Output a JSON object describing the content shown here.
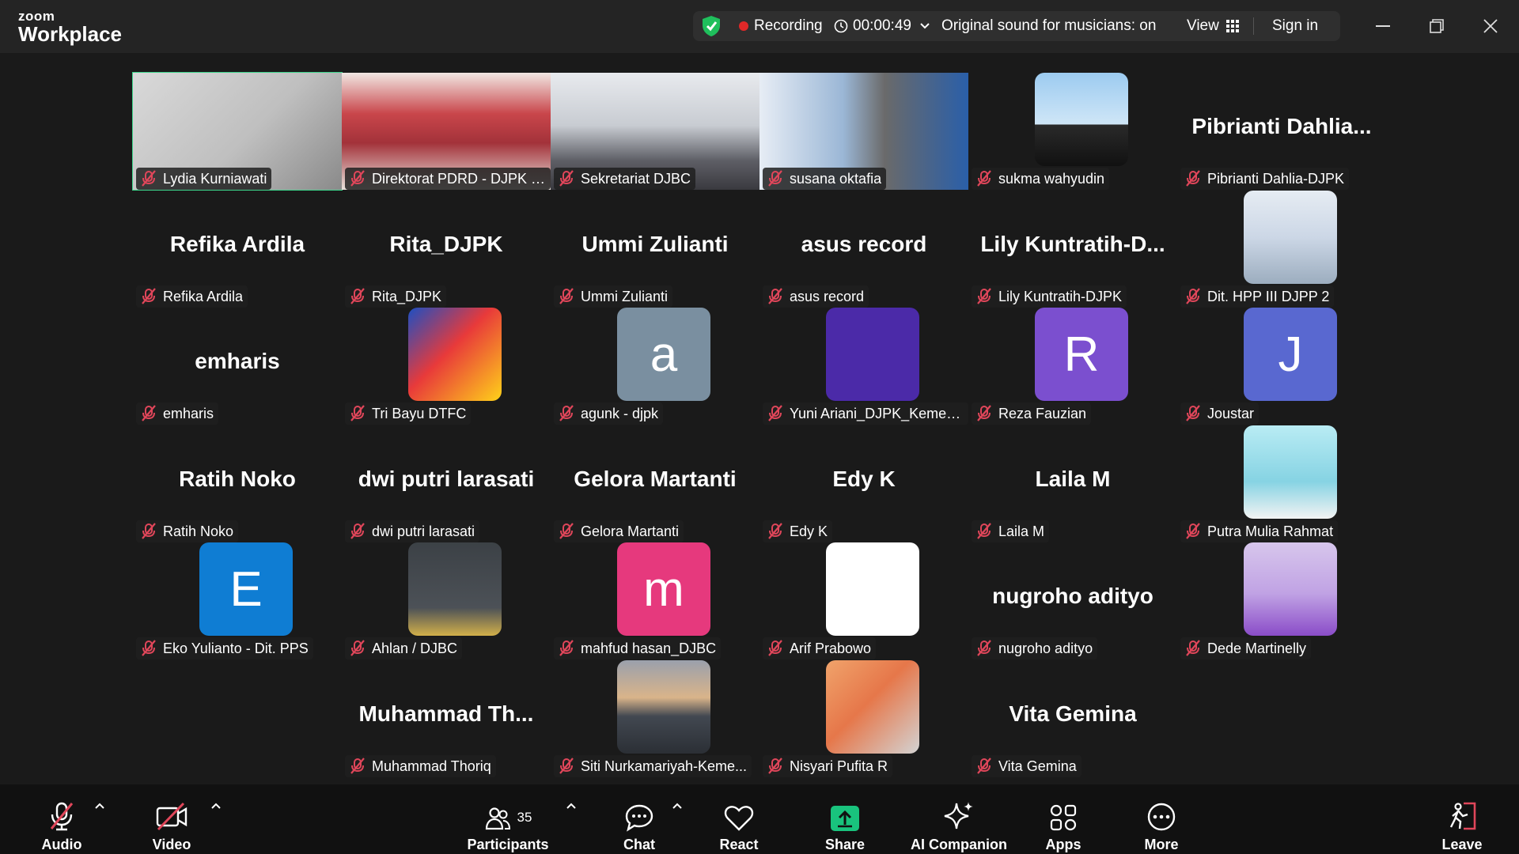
{
  "app": {
    "brand_top": "zoom",
    "brand_bottom": "Workplace"
  },
  "topbar": {
    "recording": "Recording",
    "timer": "00:00:49",
    "original_sound": "Original sound for musicians: on",
    "view": "View",
    "sign_in": "Sign in"
  },
  "colors": {
    "active_speaker": "#3dd68c",
    "mute": "#e0465a",
    "share": "#19c37d"
  },
  "tiles": [
    {
      "label": "Lydia Kurniawati",
      "type": "video",
      "active": true
    },
    {
      "label": "Direktorat PDRD - DJPK - ...",
      "type": "video"
    },
    {
      "label": "Sekretariat DJBC",
      "type": "video"
    },
    {
      "label": "susana oktafia",
      "type": "video"
    },
    {
      "label": "sukma wahyudin",
      "type": "photo"
    },
    {
      "label": "Pibrianti Dahlia-DJPK",
      "type": "name",
      "big": "Pibrianti  Dahlia..."
    },
    {
      "label": "Refika Ardila",
      "type": "name",
      "big": "Refika Ardila"
    },
    {
      "label": "Rita_DJPK",
      "type": "name",
      "big": "Rita_DJPK"
    },
    {
      "label": "Ummi Zulianti",
      "type": "name",
      "big": "Ummi Zulianti"
    },
    {
      "label": "asus record",
      "type": "name",
      "big": "asus record"
    },
    {
      "label": "Lily Kuntratih-DJPK",
      "type": "name",
      "big": "Lily  Kuntratih-D..."
    },
    {
      "label": "Dit. HPP III DJPP 2",
      "type": "photo"
    },
    {
      "label": "emharis",
      "type": "name",
      "big": "emharis"
    },
    {
      "label": "Tri Bayu DTFC",
      "type": "photo"
    },
    {
      "label": "agunk - djpk",
      "type": "letter",
      "letter": "a",
      "color": "#7a8fa0"
    },
    {
      "label": "Yuni Ariani_DJPK_Kemen...",
      "type": "letter",
      "letter": "",
      "color": "#4b2aa8"
    },
    {
      "label": "Reza Fauzian",
      "type": "letter",
      "letter": "R",
      "color": "#7b4fcf"
    },
    {
      "label": "Joustar",
      "type": "letter",
      "letter": "J",
      "color": "#5968d0"
    },
    {
      "label": "Ratih Noko",
      "type": "name",
      "big": "Ratih Noko"
    },
    {
      "label": "dwi putri larasati",
      "type": "name",
      "big": "dwi putri larasati"
    },
    {
      "label": "Gelora Martanti",
      "type": "name",
      "big": "Gelora Martanti"
    },
    {
      "label": "Edy K",
      "type": "name",
      "big": "Edy K"
    },
    {
      "label": "Laila M",
      "type": "name",
      "big": "Laila M"
    },
    {
      "label": "Putra Mulia Rahmat",
      "type": "photo"
    },
    {
      "label": "Eko Yulianto - Dit. PPS",
      "type": "letter",
      "letter": "E",
      "color": "#0f7dd3"
    },
    {
      "label": "Ahlan / DJBC",
      "type": "photo"
    },
    {
      "label": "mahfud hasan_DJBC",
      "type": "letter",
      "letter": "m",
      "color": "#e6397d"
    },
    {
      "label": "Arif Prabowo",
      "type": "photo"
    },
    {
      "label": "nugroho adityo",
      "type": "name",
      "big": "nugroho adityo"
    },
    {
      "label": "Dede Martinelly",
      "type": "photo"
    },
    {
      "label": "",
      "type": "empty"
    },
    {
      "label": "Muhammad Thoriq",
      "type": "name",
      "big": "Muhammad  Th..."
    },
    {
      "label": "Siti Nurkamariyah-Keme...",
      "type": "photo"
    },
    {
      "label": "Nisyari Pufita R",
      "type": "photo"
    },
    {
      "label": "Vita Gemina",
      "type": "name",
      "big": "Vita Gemina"
    }
  ],
  "toolbar": {
    "audio": "Audio",
    "video": "Video",
    "participants": "Participants",
    "participants_count": "35",
    "chat": "Chat",
    "react": "React",
    "share": "Share",
    "ai": "AI Companion",
    "apps": "Apps",
    "more": "More",
    "leave": "Leave"
  }
}
